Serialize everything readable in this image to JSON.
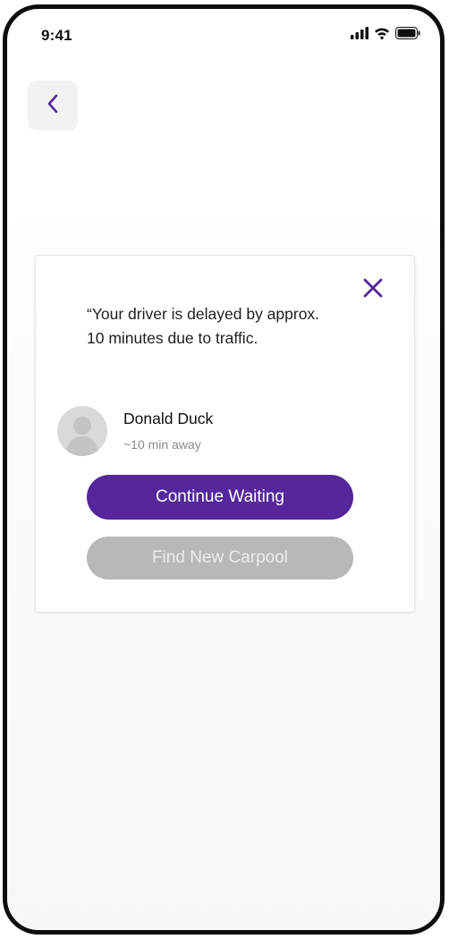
{
  "status_bar": {
    "time": "9:41",
    "icons": [
      "cellular-signal-icon",
      "wifi-icon",
      "battery-icon"
    ]
  },
  "header": {
    "back_icon": "chevron-left-icon"
  },
  "dialog": {
    "close_icon": "close-icon",
    "message": "“Your driver is delayed by approx. 10 minutes due to traffic.",
    "driver": {
      "name": "Donald Duck",
      "eta": "~10 min away",
      "avatar_icon": "person-avatar-icon"
    },
    "primary_button_label": "Continue Waiting",
    "secondary_button_label": "Find New Carpool"
  },
  "colors": {
    "accent": "#55269c",
    "disabled_button": "#b8b8b8",
    "back_button_bg": "#f2f2f4"
  }
}
